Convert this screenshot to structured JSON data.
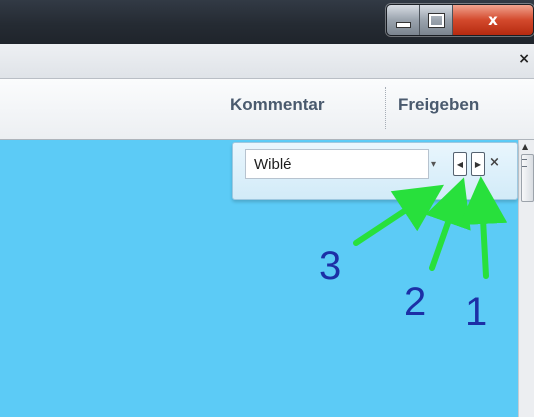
{
  "window": {
    "buttons": {
      "minimize_icon": "minimize-icon",
      "maximize_icon": "maximize-icon",
      "close_glyph": "x"
    },
    "tabbar": {
      "close_glyph": "×"
    },
    "toolbar": {
      "kommentar_label": "Kommentar",
      "freigeben_label": "Freigeben"
    }
  },
  "findbar": {
    "search_value": "Wiblé",
    "dropdown_glyph": "▾",
    "prev_glyph": "◀",
    "next_glyph": "▶",
    "close_glyph": "×"
  },
  "annotations": {
    "labels": [
      "3",
      "2",
      "1"
    ],
    "arrow_color": "#28e03c",
    "number_color": "#1c2fa6"
  },
  "colors": {
    "content_bg": "#5ccbf6",
    "titlebar": "#252b33",
    "close_button": "#d3492c"
  },
  "scrollbar": {
    "up_glyph": "▲"
  }
}
